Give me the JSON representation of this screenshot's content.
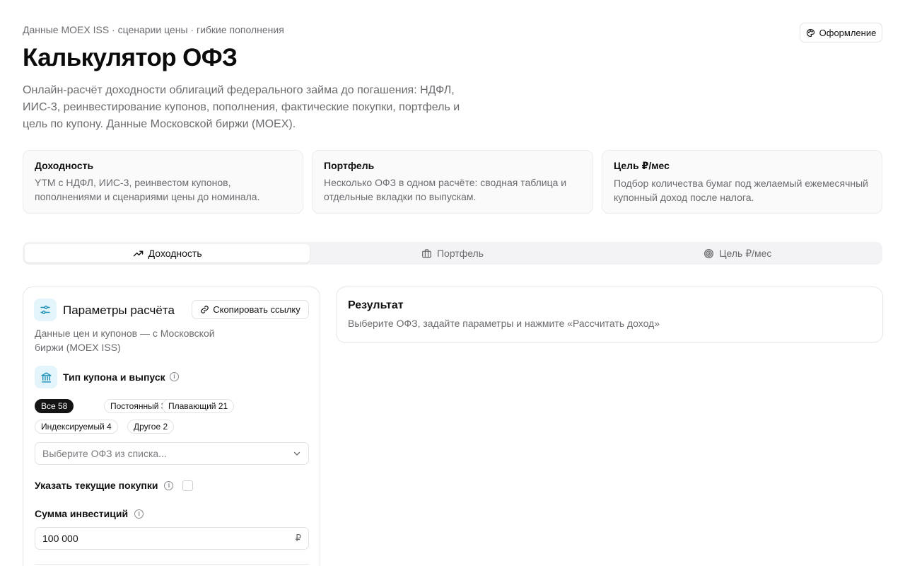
{
  "header": {
    "eyebrow": "Данные MOEX ISS · сценарии цены · гибкие пополнения",
    "theme_button": "Оформление",
    "title": "Калькулятор ОФЗ",
    "lead": "Онлайн-расчёт доходности облигаций федерального займа до погашения: НДФЛ, ИИС-3, реинвестирование купонов, пополнения, фактические покупки, портфель и цель по купону. Данные Московской биржи (MOEX)."
  },
  "features": [
    {
      "title": "Доходность",
      "desc": "YTM с НДФЛ, ИИС-3, реинвестом купонов, пополнениями и сценариями цены до номинала."
    },
    {
      "title": "Портфель",
      "desc": "Несколько ОФЗ в одном расчёте: сводная таблица и отдельные вкладки по выпускам."
    },
    {
      "title": "Цель ₽/мес",
      "desc": "Подбор количества бумаг под желаемый ежемесячный купонный доход после налога."
    }
  ],
  "tabs": [
    {
      "label": "Доходность",
      "icon": "trending-up-icon",
      "active": true
    },
    {
      "label": "Портфель",
      "icon": "briefcase-icon",
      "active": false
    },
    {
      "label": "Цель ₽/мес",
      "icon": "target-icon",
      "active": false
    }
  ],
  "params": {
    "title": "Параметры расчёта",
    "copy_link": "Скопировать ссылку",
    "desc": "Данные цен и купонов — с Московской биржи (MOEX ISS)",
    "coupon_section": "Тип купона и выпуск",
    "chips": [
      {
        "label": "Все 58",
        "active": true
      },
      {
        "label": "Постоянный 31",
        "active": false
      },
      {
        "label": "Плавающий 21",
        "active": false
      },
      {
        "label": "Индексируемый 4",
        "active": false
      },
      {
        "label": "Другое 2",
        "active": false
      }
    ],
    "select_placeholder": "Выберите ОФЗ из списка...",
    "current_purchases_label": "Указать текущие покупки",
    "current_purchases_checked": false,
    "investment_label": "Сумма инвестиций",
    "investment_value": "100 000",
    "currency": "₽",
    "info_glyph": "i"
  },
  "result": {
    "title": "Результат",
    "desc": "Выберите ОФЗ, задайте параметры и нажмите «Рассчитать доход»"
  },
  "colors": {
    "accent_bg": "#e4f4fb",
    "accent_icon": "#1a8fb8",
    "active_chip": "#141414",
    "muted_text": "#6b6b70"
  }
}
